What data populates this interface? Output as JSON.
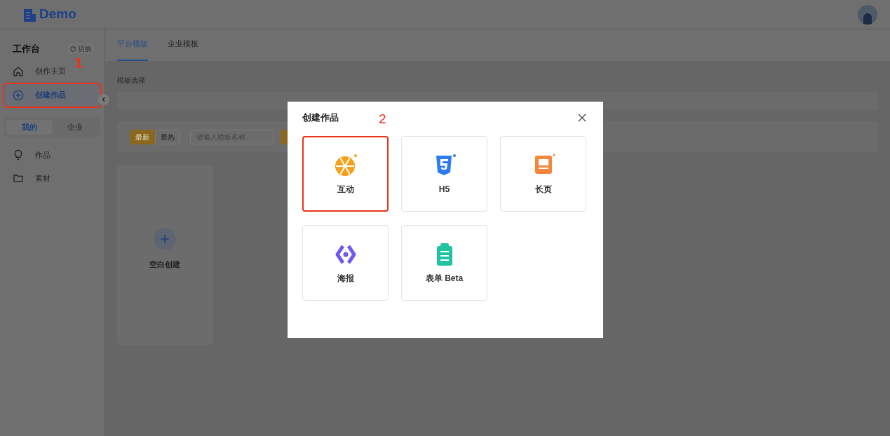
{
  "header": {
    "logo": "Demo"
  },
  "sidebar": {
    "title": "工作台",
    "switch_label": "切换",
    "items": [
      {
        "kind": "home",
        "label": "创作主页",
        "selected": false,
        "highlighted": false
      },
      {
        "kind": "create",
        "label": "创建作品",
        "selected": true,
        "highlighted": true
      }
    ],
    "segments": [
      {
        "label": "我的",
        "selected": true
      },
      {
        "label": "企业",
        "selected": false
      }
    ],
    "links": [
      {
        "kind": "bulb",
        "label": "作品"
      },
      {
        "kind": "folder",
        "label": "素材"
      }
    ]
  },
  "annotations": [
    {
      "label": "1"
    },
    {
      "label": "2"
    }
  ],
  "tabs": [
    {
      "label": "平台模板",
      "selected": true
    },
    {
      "label": "企业模板",
      "selected": false
    }
  ],
  "section_label": "模板选择",
  "sort_buttons": [
    {
      "label": "最新",
      "selected": true
    },
    {
      "label": "最热",
      "selected": false
    }
  ],
  "search": {
    "placeholder": "请输入模板名称"
  },
  "blank_card": {
    "label": "空白创建"
  },
  "dialog": {
    "title": "创建作品",
    "options": [
      {
        "kind": "interactive",
        "label": "互动",
        "highlighted": true
      },
      {
        "kind": "h5",
        "label": "H5",
        "highlighted": false
      },
      {
        "kind": "longpage",
        "label": "长页",
        "highlighted": false
      },
      {
        "kind": "poster",
        "label": "海报",
        "highlighted": false
      },
      {
        "kind": "form",
        "label": "表单 Beta",
        "highlighted": false
      }
    ]
  }
}
